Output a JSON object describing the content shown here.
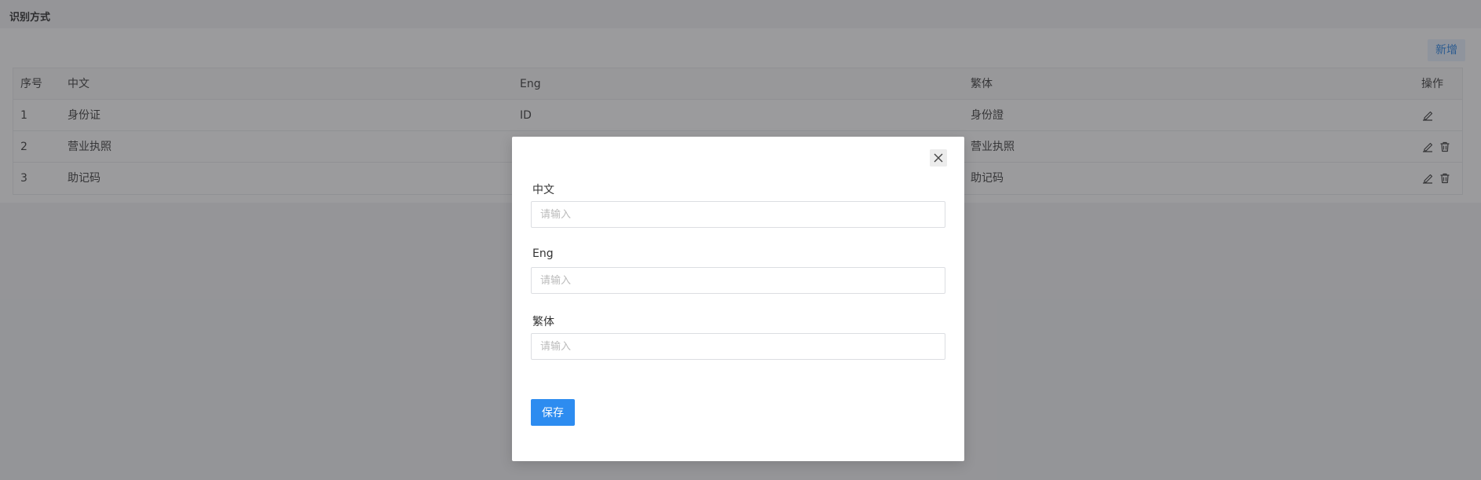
{
  "page": {
    "title": "识别方式"
  },
  "toolbar": {
    "add_label": "新增"
  },
  "table": {
    "headers": {
      "no": "序号",
      "zh": "中文",
      "en": "Eng",
      "tw": "繁体",
      "op": "操作"
    },
    "rows": [
      {
        "no": "1",
        "zh": "身份证",
        "en": "ID",
        "tw": "身份證",
        "deletable": false
      },
      {
        "no": "2",
        "zh": "营业执照",
        "en": "",
        "tw": "营业执照",
        "deletable": true
      },
      {
        "no": "3",
        "zh": "助记码",
        "en": "",
        "tw": "助记码",
        "deletable": true
      }
    ]
  },
  "modal": {
    "fields": {
      "zh": {
        "label": "中文",
        "placeholder": "请输入",
        "value": ""
      },
      "en": {
        "label": "Eng",
        "placeholder": "请输入",
        "value": ""
      },
      "tw": {
        "label": "繁体",
        "placeholder": "请输入",
        "value": ""
      }
    },
    "save_label": "保存",
    "close_icon": "close-icon"
  },
  "colors": {
    "primary": "#2d8cf0",
    "add_bg": "#e7f1ff",
    "mask": "rgba(55,55,60,0.5)"
  }
}
